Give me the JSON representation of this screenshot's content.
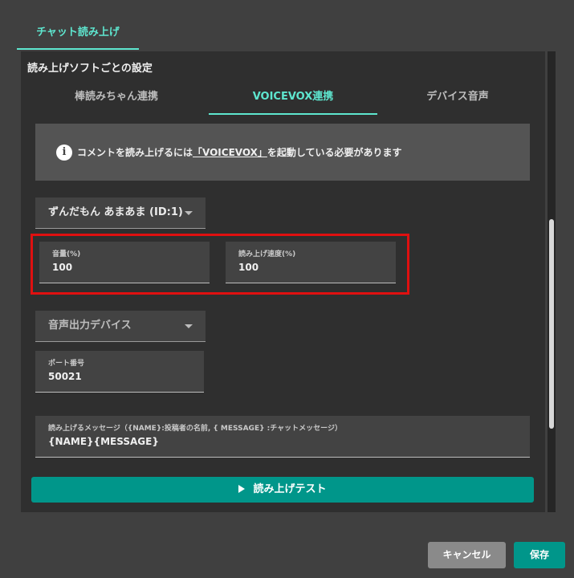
{
  "top_tabs": [
    {
      "label": "チャット読み上げ"
    }
  ],
  "section": {
    "title": "読み上げソフトごとの設定"
  },
  "sub_tabs": [
    {
      "label": "棒読みちゃん連携"
    },
    {
      "label": "VOICEVOX連携"
    },
    {
      "label": "デバイス音声"
    }
  ],
  "notice": {
    "icon": "info-icon",
    "prefix": "コメントを読み上げるには",
    "link": "「VOICEVOX」",
    "suffix": "を起動している必要があります"
  },
  "speaker": {
    "value": "ずんだもん あまあま (ID:1)"
  },
  "volume": {
    "label": "音量(%)",
    "value": "100"
  },
  "speed": {
    "label": "読み上げ速度(%)",
    "value": "100"
  },
  "output_device": {
    "placeholder": "音声出力デバイス"
  },
  "port": {
    "label": "ポート番号",
    "value": "50021"
  },
  "message": {
    "label": "読み上げるメッセージ（{NAME}:投稿者の名前, { MESSAGE} :チャットメッセージ）",
    "value": "{NAME}{MESSAGE}"
  },
  "test_button": {
    "label": "読み上げテスト"
  },
  "footer": {
    "cancel": "キャンセル",
    "save": "保存"
  },
  "colors": {
    "accent": "#5ee6cf",
    "primary": "#00968a",
    "highlight": "#e01010"
  }
}
